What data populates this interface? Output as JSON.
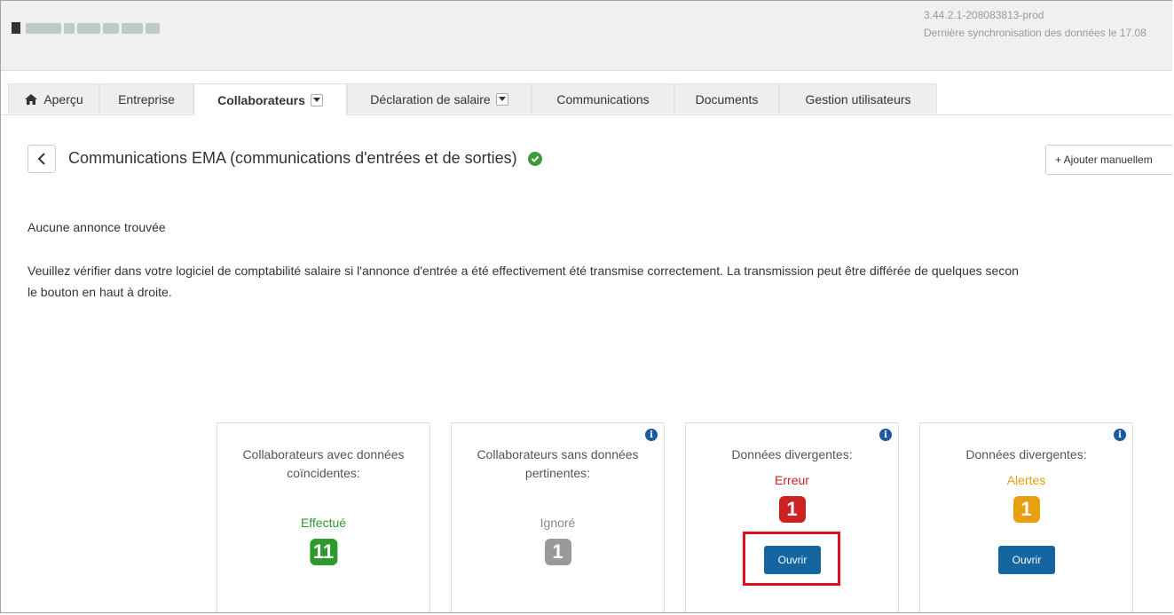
{
  "header": {
    "version": "3.44.2.1-208083813-prod",
    "sync": "Dernière synchronisation des données le 17.08"
  },
  "tabs": [
    {
      "label": "Aperçu",
      "icon": "home-icon"
    },
    {
      "label": "Entreprise"
    },
    {
      "label": "Collaborateurs",
      "active": true,
      "dropdown": true
    },
    {
      "label": "Déclaration de salaire",
      "dropdown": true
    },
    {
      "label": "Communications"
    },
    {
      "label": "Documents"
    },
    {
      "label": "Gestion utilisateurs"
    }
  ],
  "page": {
    "title": "Communications EMA (communications d'entrées et de sorties)",
    "add_button": "+ Ajouter manuellem",
    "no_results": "Aucune annonce trouvée",
    "message_line1": "Veuillez vérifier dans votre logiciel de comptabilité salaire si l'annonce d'entrée a été effectivement été transmise correctement. La transmission peut être différée de quelques secon",
    "message_line2": "le bouton en haut à droite."
  },
  "cards": [
    {
      "label_line1": "Collaborateurs avec données",
      "label_line2": "coïncidentes:",
      "status": "Effectué",
      "count": "11",
      "color": "#2e9a2e",
      "info": false
    },
    {
      "label_line1": "Collaborateurs sans données",
      "label_line2": "pertinentes:",
      "status": "Ignoré",
      "count": "1",
      "color": "#999999",
      "info": true
    },
    {
      "label_line1": "Données divergentes:",
      "label_line2": "",
      "status": "Erreur",
      "count": "1",
      "color": "#cc2222",
      "info": true,
      "button": "Ouvrir"
    },
    {
      "label_line1": "Données divergentes:",
      "label_line2": "",
      "status": "Alertes",
      "count": "1",
      "color": "#e8a010",
      "info": true,
      "button": "Ouvrir"
    }
  ]
}
